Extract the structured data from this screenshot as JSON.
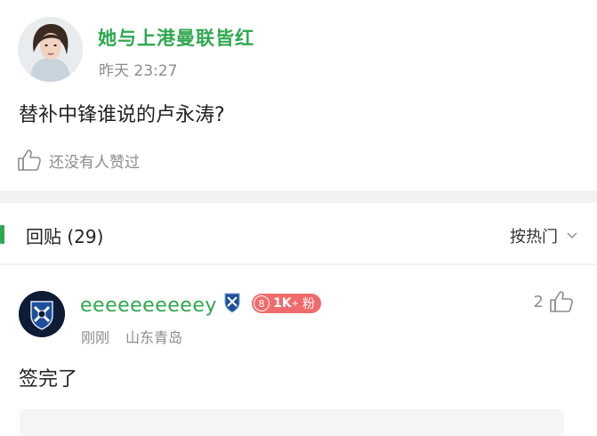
{
  "post": {
    "author": "她与上港曼联皆红",
    "time": "昨天 23:27",
    "body": "替补中锋谁说的卢永涛?",
    "like_text": "还没有人赞过"
  },
  "replies": {
    "title": "回贴 (29)",
    "sort_label": "按热门",
    "items": [
      {
        "username": "eeeeeeeeeey",
        "fan_badge": {
          "level_icon": "8",
          "count": "1K",
          "suffix": "粉"
        },
        "time": "刚刚",
        "location": "山东青岛",
        "likes": "2",
        "body": "签完了"
      }
    ]
  },
  "colors": {
    "accent_green": "#2fa84f",
    "badge_red": "#f06b6b",
    "muted_text": "#8c8c8c"
  },
  "icons": [
    "thumbs-up-icon",
    "chevron-down-icon",
    "team-crest-icon"
  ]
}
